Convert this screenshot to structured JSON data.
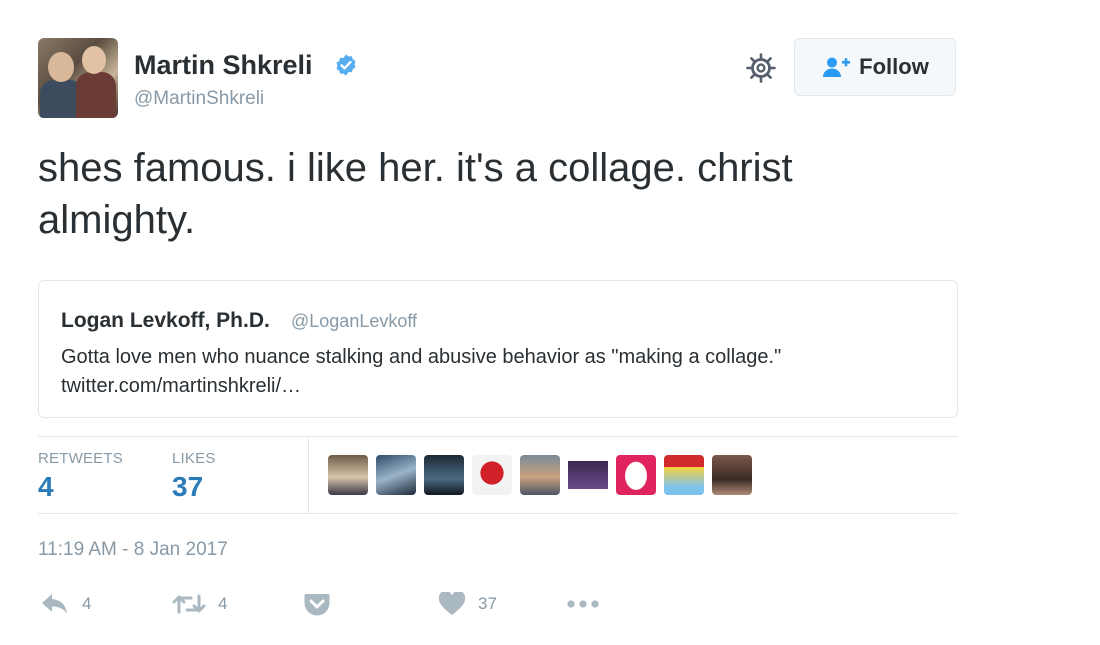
{
  "tweet": {
    "user": {
      "name": "Martin Shkreli",
      "handle": "@MartinShkreli"
    },
    "follow_label": "Follow",
    "text": "shes famous. i like her. it's a collage. christ almighty.",
    "quoted": {
      "name": "Logan Levkoff, Ph.D.",
      "handle": "@LoganLevkoff",
      "text": "Gotta love men who nuance stalking and abusive behavior as \"making a collage.\" twitter.com/martinshkreli/…"
    },
    "stats": {
      "retweets_label": "RETWEETS",
      "retweets": "4",
      "likes_label": "LIKES",
      "likes": "37"
    },
    "timestamp": "11:19 AM - 8 Jan 2017",
    "actions": {
      "reply_count": "4",
      "retweet_count": "4",
      "like_count": "37"
    }
  },
  "icons": {
    "verified": "verified-badge-icon",
    "settings": "gear-icon",
    "follow": "add-user-icon",
    "reply": "reply-icon",
    "retweet": "retweet-icon",
    "save": "pocket-save-icon",
    "like": "heart-icon",
    "more": "more-dots-icon"
  },
  "colors": {
    "verified": "#55acee",
    "link_blue": "#2b7bb9",
    "text": "#292f33",
    "muted": "#8899a6",
    "border": "#e1e8ed",
    "icon_gray": "#aab8c2"
  }
}
